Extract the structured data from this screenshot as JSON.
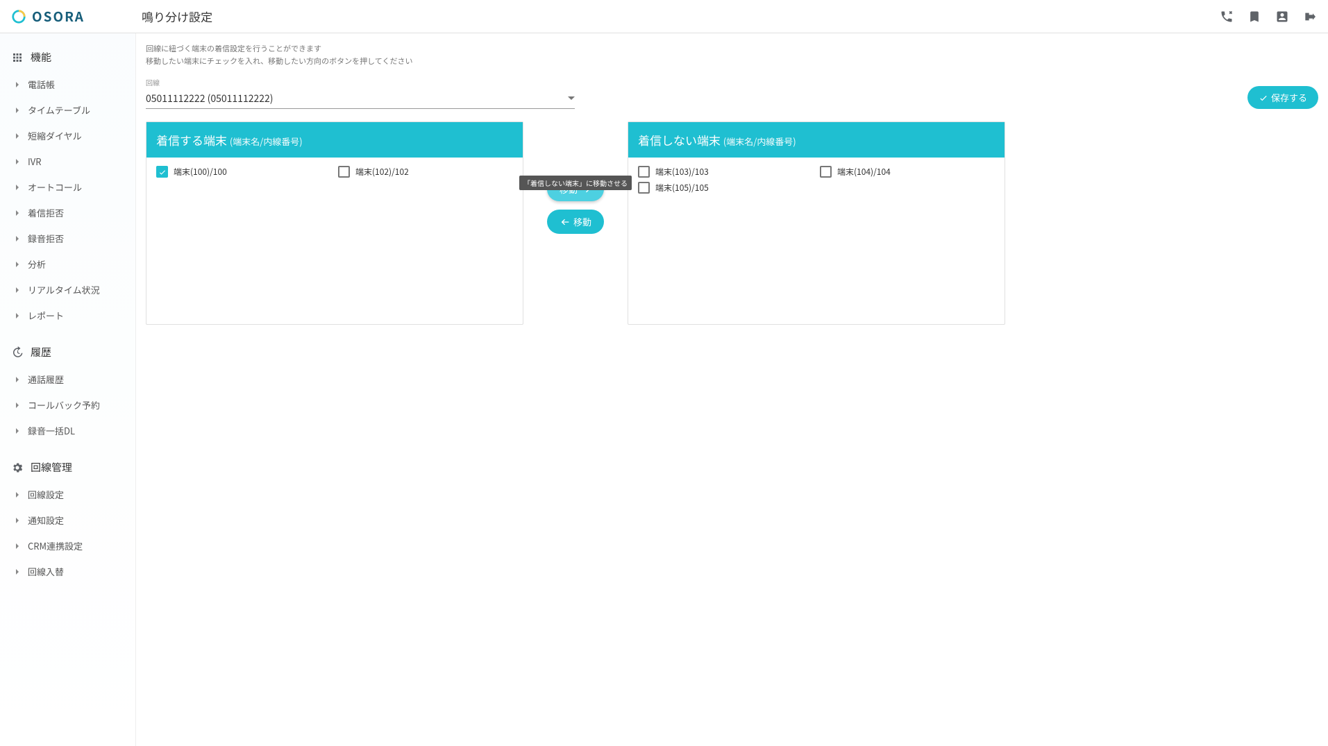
{
  "brand": "OSORA",
  "page_title": "鳴り分け設定",
  "description_line1": "回線に紐づく端末の着信設定を行うことができます",
  "description_line2": "移動したい端末にチェックを入れ、移動したい方向のボタンを押してください",
  "line_label": "回線",
  "line_value": "05011112222 (05011112222)",
  "save_label": "保存する",
  "move_label": "移動",
  "tooltip_move_right": "「着信しない端末」に移動させる",
  "panel_receive": {
    "title": "着信する端末",
    "sub": "(端末名/内線番号)"
  },
  "panel_noreceive": {
    "title": "着信しない端末",
    "sub": "(端末名/内線番号)"
  },
  "receive_items": [
    {
      "label": "端末(100)/100",
      "checked": true
    },
    {
      "label": "端末(102)/102",
      "checked": false
    }
  ],
  "noreceive_items": [
    {
      "label": "端末(103)/103",
      "checked": false
    },
    {
      "label": "端末(104)/104",
      "checked": false
    },
    {
      "label": "端末(105)/105",
      "checked": false
    }
  ],
  "sidebar": {
    "section_features": "機能",
    "section_history": "履歴",
    "section_line": "回線管理",
    "features": [
      "電話帳",
      "タイムテーブル",
      "短縮ダイヤル",
      "IVR",
      "オートコール",
      "着信拒否",
      "録音拒否",
      "分析",
      "リアルタイム状況",
      "レポート"
    ],
    "history": [
      "通話履歴",
      "コールバック予約",
      "録音一括DL"
    ],
    "line": [
      "回線設定",
      "通知設定",
      "CRM連携設定",
      "回線入替"
    ]
  }
}
